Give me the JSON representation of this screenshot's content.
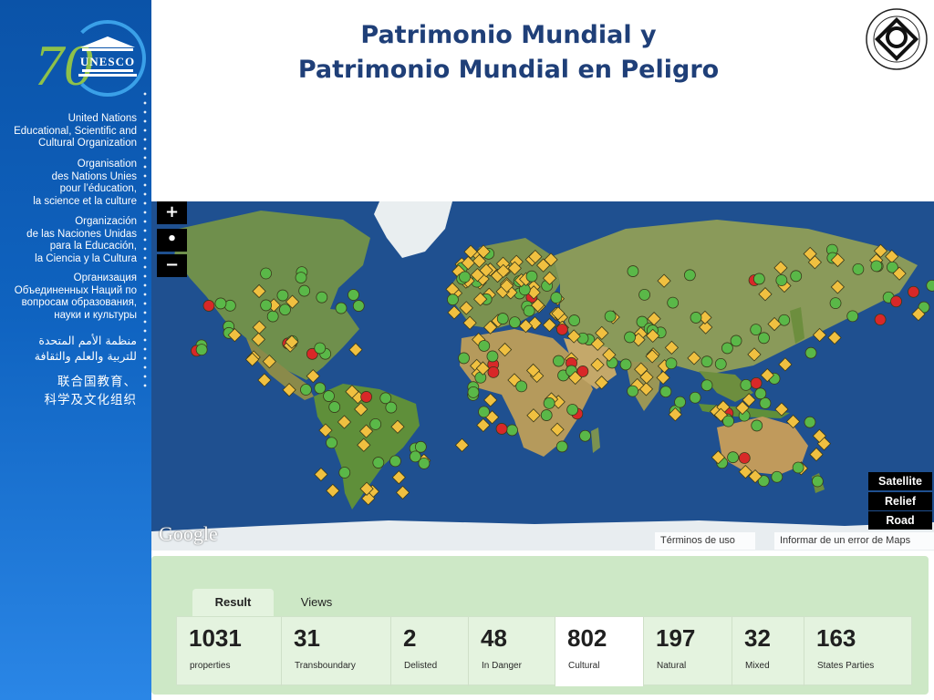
{
  "title": {
    "line1": "Patrimonio Mundial y",
    "line2": "Patrimonio Mundial en Peligro"
  },
  "sidebar": {
    "logo_number": "70",
    "logo_text": "UNESCO",
    "organizations": [
      {
        "lang": "en",
        "lines": [
          "United Nations",
          "Educational, Scientific and",
          "Cultural Organization"
        ]
      },
      {
        "lang": "fr",
        "lines": [
          "Organisation",
          "des Nations Unies",
          "pour l’éducation,",
          "la science et la culture"
        ]
      },
      {
        "lang": "es",
        "lines": [
          "Organización",
          "de las Naciones Unidas",
          "para la Educación,",
          "la Ciencia y la Cultura"
        ]
      },
      {
        "lang": "ru",
        "lines": [
          "Организация",
          "Объединенных Наций по",
          "вопросам образования,",
          "науки и культуры"
        ]
      },
      {
        "lang": "ar",
        "lines": [
          "منظمة الأمم المتحدة",
          "للتربية والعلم والثقافة"
        ]
      },
      {
        "lang": "zh",
        "lines": [
          "联合国教育、",
          "科学及文化组织"
        ]
      }
    ]
  },
  "emblem": {
    "icon": "world-heritage-emblem-icon"
  },
  "map": {
    "zoom_in_label": "+",
    "zoom_reset_label": "•",
    "zoom_out_label": "−",
    "map_types": [
      "Satellite",
      "Relief",
      "Road"
    ],
    "google_logo": "Google",
    "terms_link": "Términos de uso",
    "report_link": "Informar de un error de Maps",
    "marker_colors": {
      "natural": "#5ab848",
      "cultural": "#f0c040",
      "danger": "#d82828"
    }
  },
  "results": {
    "tabs": [
      "Result",
      "Views"
    ],
    "active_tab": "Result",
    "stats": [
      {
        "value": "1031",
        "label": "properties"
      },
      {
        "value": "31",
        "label": "Transboundary"
      },
      {
        "value": "2",
        "label": "Delisted"
      },
      {
        "value": "48",
        "label": "In Danger"
      },
      {
        "value": "802",
        "label": "Cultural"
      },
      {
        "value": "197",
        "label": "Natural"
      },
      {
        "value": "32",
        "label": "Mixed"
      },
      {
        "value": "163",
        "label": "States Parties"
      }
    ]
  }
}
